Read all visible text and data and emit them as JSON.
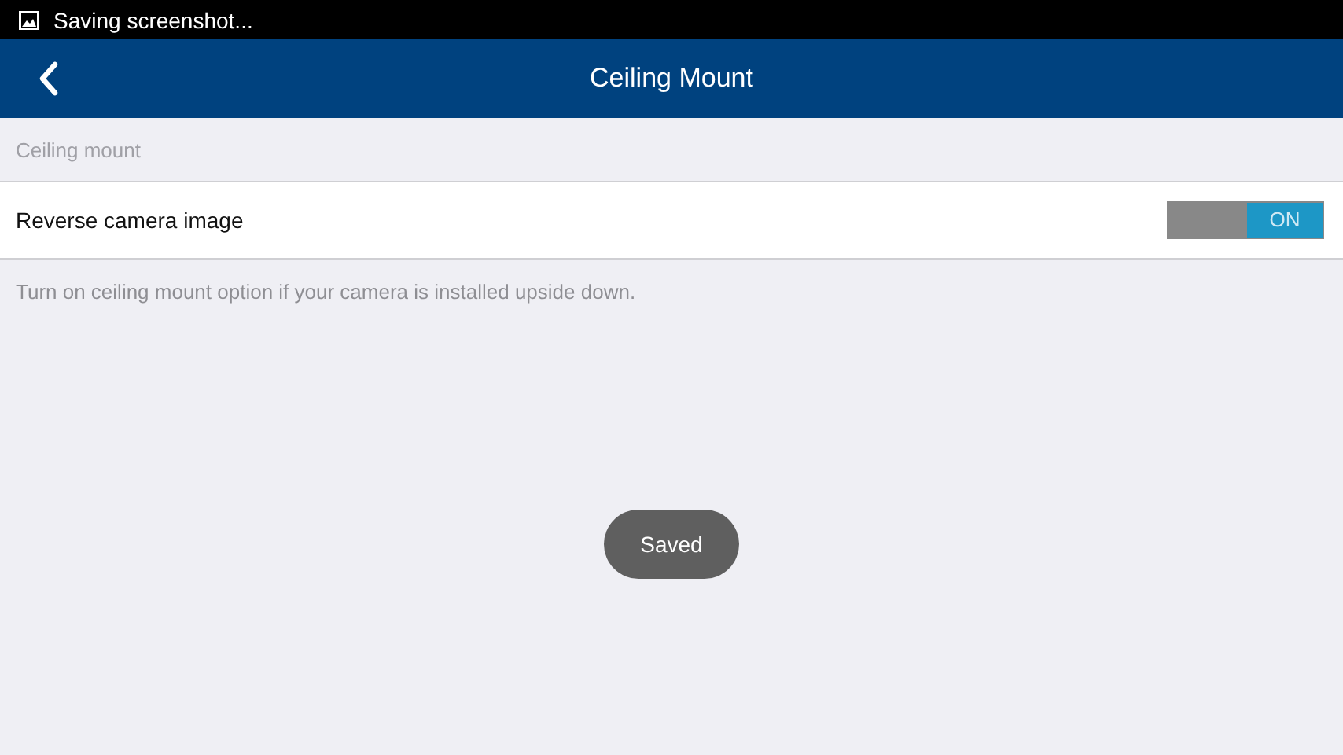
{
  "status_bar": {
    "notification": "Saving screenshot..."
  },
  "app_bar": {
    "title": "Ceiling Mount"
  },
  "section": {
    "header": "Ceiling mount"
  },
  "setting": {
    "label": "Reverse camera image",
    "toggle": {
      "on": true,
      "text": "ON"
    }
  },
  "hint": "Turn on ceiling mount option if your camera is installed upside down.",
  "toast": "Saved"
}
